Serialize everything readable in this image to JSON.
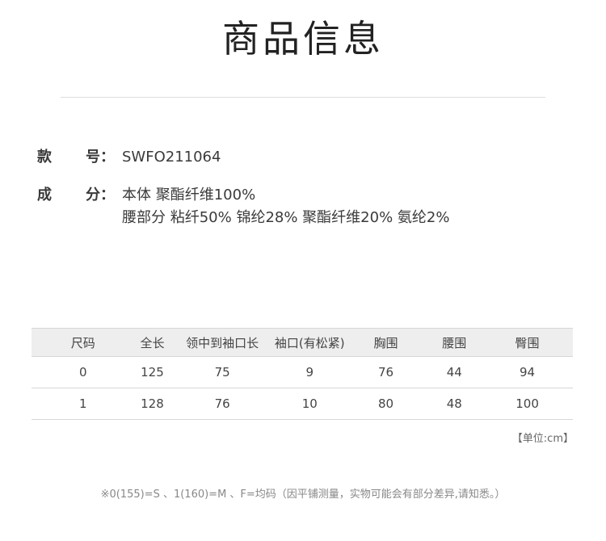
{
  "header": {
    "title": "商品信息"
  },
  "info": {
    "style": {
      "label_a": "款",
      "label_b": "号：",
      "value": "SWFO211064"
    },
    "composition": {
      "label_a": "成",
      "label_b": "分：",
      "line1": "本体  聚酯纤维100%",
      "line2": "腰部分 粘纤50%  锦纶28%  聚酯纤维20%  氨纶2%"
    }
  },
  "size_table": {
    "headers": [
      "尺码",
      "全长",
      "领中到袖口长",
      "袖口(有松紧)",
      "胸围",
      "腰围",
      "臀围"
    ],
    "rows": [
      [
        "0",
        "125",
        "75",
        "9",
        "76",
        "44",
        "94"
      ],
      [
        "1",
        "128",
        "76",
        "10",
        "80",
        "48",
        "100"
      ]
    ]
  },
  "unit_note": "【单位:cm】",
  "footnote": "※0(155)=S 、1(160)=M 、F=均码（因平铺测量，实物可能会有部分差异,请知悉。）"
}
